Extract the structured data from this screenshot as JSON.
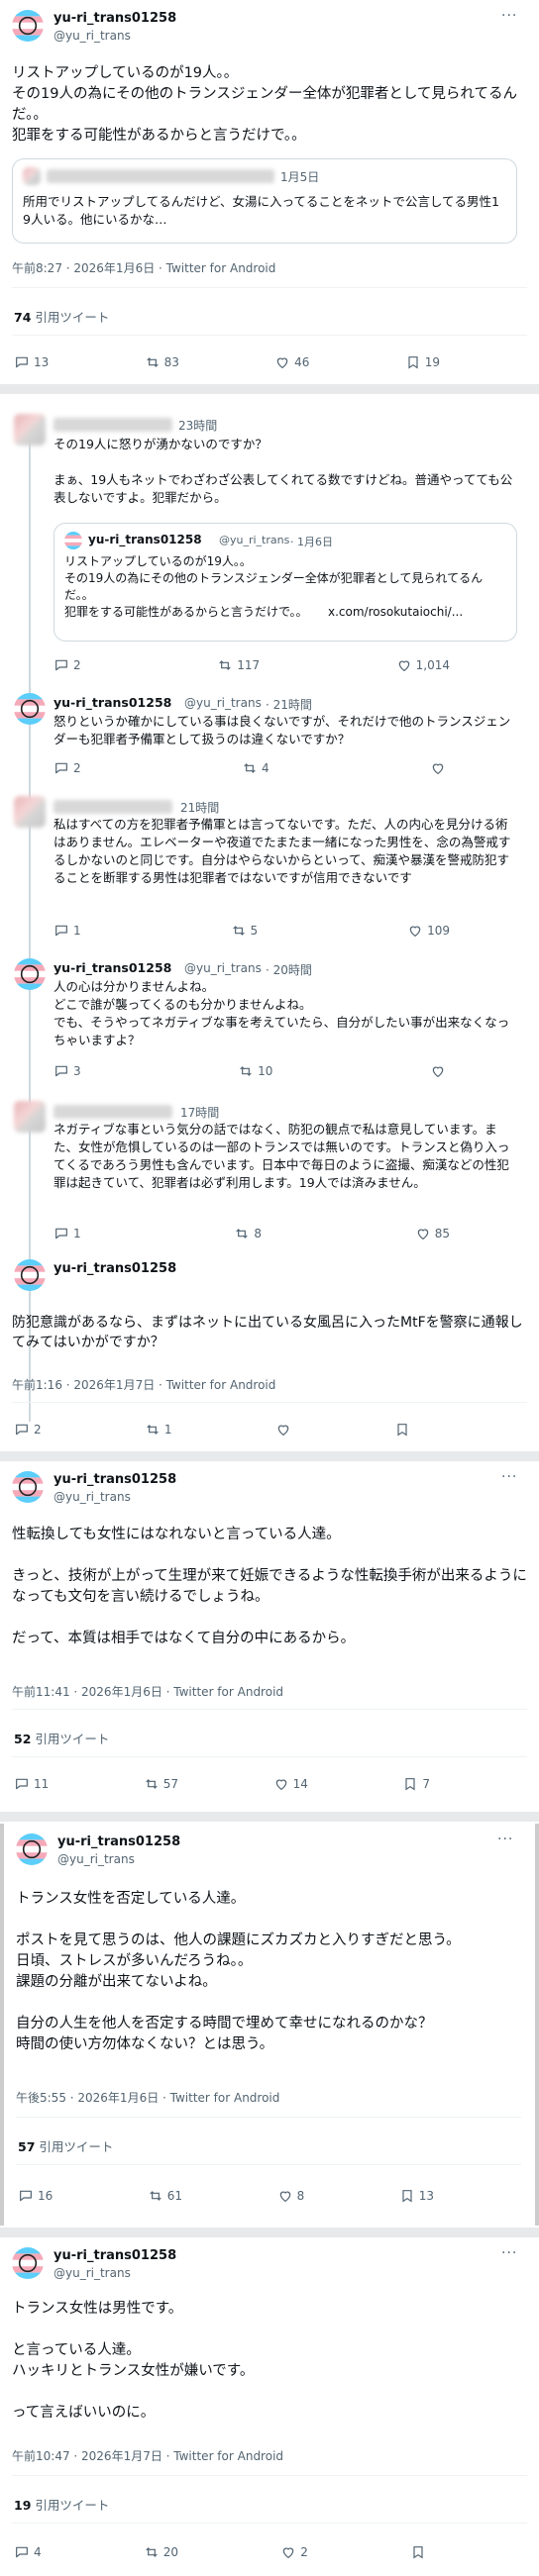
{
  "author": {
    "name": "yu-ri_trans01258",
    "handle": "@yu_ri_trans"
  },
  "icons": {
    "reply": "comment-icon",
    "repost": "repost-icon",
    "like": "heart-icon",
    "bookmark": "bookmark-icon",
    "more": "more-icon",
    "avatar": "trans-flag-avatar"
  },
  "colors": {
    "flag_blue": "#5BCEFA",
    "flag_pink": "#F5A9B8",
    "flag_white": "#FFFFFF",
    "muted": "#536471",
    "border": "#cfd9de",
    "divider": "#e7e9ea"
  },
  "more_label": "···",
  "post1": {
    "name": "yu-ri_trans01258",
    "handle": "@yu_ri_trans",
    "text": "リストアップしているのが19人。。\nその19人の為にその他のトランスジェンダー全体が犯罪者として見られてるんだ。。\n犯罪をする可能性があるからと言うだけで。。",
    "quote_date": "1月5日",
    "quote_text": "所用でリストアップしてるんだけど、女湯に入ってることをネットで公言してる男性19人いる。他にいるかな…",
    "meta": "午前8:27 · 2026年1月6日 · Twitter for Android",
    "quotes_count": "74",
    "quotes_label": "引用ツイート",
    "replies": "13",
    "reposts": "83",
    "likes": "46",
    "bookmarks": "19"
  },
  "thread": {
    "r1": {
      "time": "23時間",
      "text": "その19人に怒りが湧かないのですか？\n\nまぁ、19人もネットでわざわざ公表してくれてる数ですけどね。普通やってても公表しないですよ。犯罪だから。",
      "quoted_name": "yu-ri_trans01258",
      "quoted_handle": "@yu_ri_trans",
      "quoted_date": "· 1月6日",
      "quoted_text": "リストアップしているのが19人。。\nその19人の為にその他のトランスジェンダー全体が犯罪者として見られてるんだ。。\n犯罪をする可能性があるからと言うだけで。。",
      "quoted_link": "x.com/rosokutaiochi/...",
      "replies": "2",
      "reposts": "117",
      "likes": "1,014"
    },
    "r2": {
      "name": "yu-ri_trans01258",
      "handle": "@yu_ri_trans",
      "time": "· 21時間",
      "text": "怒りというか確かにしている事は良くないですが、それだけで他のトランスジェンダーも犯罪者予備軍として扱うのは違くないですか？",
      "replies": "2",
      "reposts": "4",
      "likes": ""
    },
    "r3": {
      "time": "21時間",
      "text": "私はすべての方を犯罪者予備軍とは言ってないです。ただ、人の内心を見分ける術はありません。エレベーターや夜道でたまたま一緒になった男性を、念の為警戒するしかないのと同じです。自分はやらないからといって、痴漢や暴漢を警戒防犯することを断罪する男性は犯罪者ではないですが信用できないです",
      "replies": "1",
      "reposts": "5",
      "likes": "109"
    },
    "r4": {
      "name": "yu-ri_trans01258",
      "handle": "@yu_ri_trans",
      "time": "· 20時間",
      "text": "人の心は分かりませんよね。\nどこで誰が襲ってくるのも分かりませんよね。\nでも、そうやってネガティブな事を考えていたら、自分がしたい事が出来なくなっちゃいますよ？",
      "replies": "3",
      "reposts": "10",
      "likes": ""
    },
    "r5": {
      "time": "17時間",
      "text": "ネガティブな事という気分の話ではなく、防犯の観点で私は意見しています。また、女性が危惧しているのは一部のトランスでは無いのです。トランスと偽り入ってくるであろう男性も含んでいます。日本中で毎日のように盗撮、痴漢などの性犯罪は起きていて、犯罪者は必ず利用します。19人では済みません。",
      "replies": "1",
      "reposts": "8",
      "likes": "85"
    },
    "main": {
      "name": "yu-ri_trans01258",
      "text": "防犯意識があるなら、まずはネットに出ている女風呂に入ったMtFを警察に通報してみてはいかがですか？",
      "meta": "午前1:16 · 2026年1月7日 · Twitter for Android",
      "replies": "2",
      "reposts": "1"
    }
  },
  "post3": {
    "name": "yu-ri_trans01258",
    "handle": "@yu_ri_trans",
    "text": "性転換しても女性にはなれないと言っている人達。\n\nきっと、技術が上がって生理が来て妊娠できるような性転換手術が出来るようになっても文句を言い続けるでしょうね。\n\nだって、本質は相手ではなくて自分の中にあるから。",
    "meta": "午前11:41 · 2026年1月6日 · Twitter for Android",
    "quotes_count": "52",
    "quotes_label": "引用ツイート",
    "replies": "11",
    "reposts": "57",
    "likes": "14",
    "bookmarks": "7"
  },
  "post4": {
    "name": "yu-ri_trans01258",
    "handle": "@yu_ri_trans",
    "text": "トランス女性を否定している人達。\n\nポストを見て思うのは、他人の課題にズカズカと入りすぎだと思う。\n日頃、ストレスが多いんだろうね。。\n課題の分離が出来てないよね。\n\n自分の人生を他人を否定する時間で埋めて幸せになれるのかな？\n時間の使い方勿体なくない？とは思う。",
    "meta": "午後5:55 · 2026年1月6日 · Twitter for Android",
    "quotes_count": "57",
    "quotes_label": "引用ツイート",
    "replies": "16",
    "reposts": "61",
    "likes": "8",
    "bookmarks": "13"
  },
  "post5": {
    "name": "yu-ri_trans01258",
    "handle": "@yu_ri_trans",
    "text": "トランス女性は男性です。\n\nと言っている人達。\nハッキリとトランス女性が嫌いです。\n\nって言えばいいのに。",
    "meta": "午前10:47 · 2026年1月7日 · Twitter for Android",
    "quotes_count": "19",
    "quotes_label": "引用ツイート",
    "replies": "4",
    "reposts": "20",
    "likes": "2",
    "bookmarks": ""
  }
}
